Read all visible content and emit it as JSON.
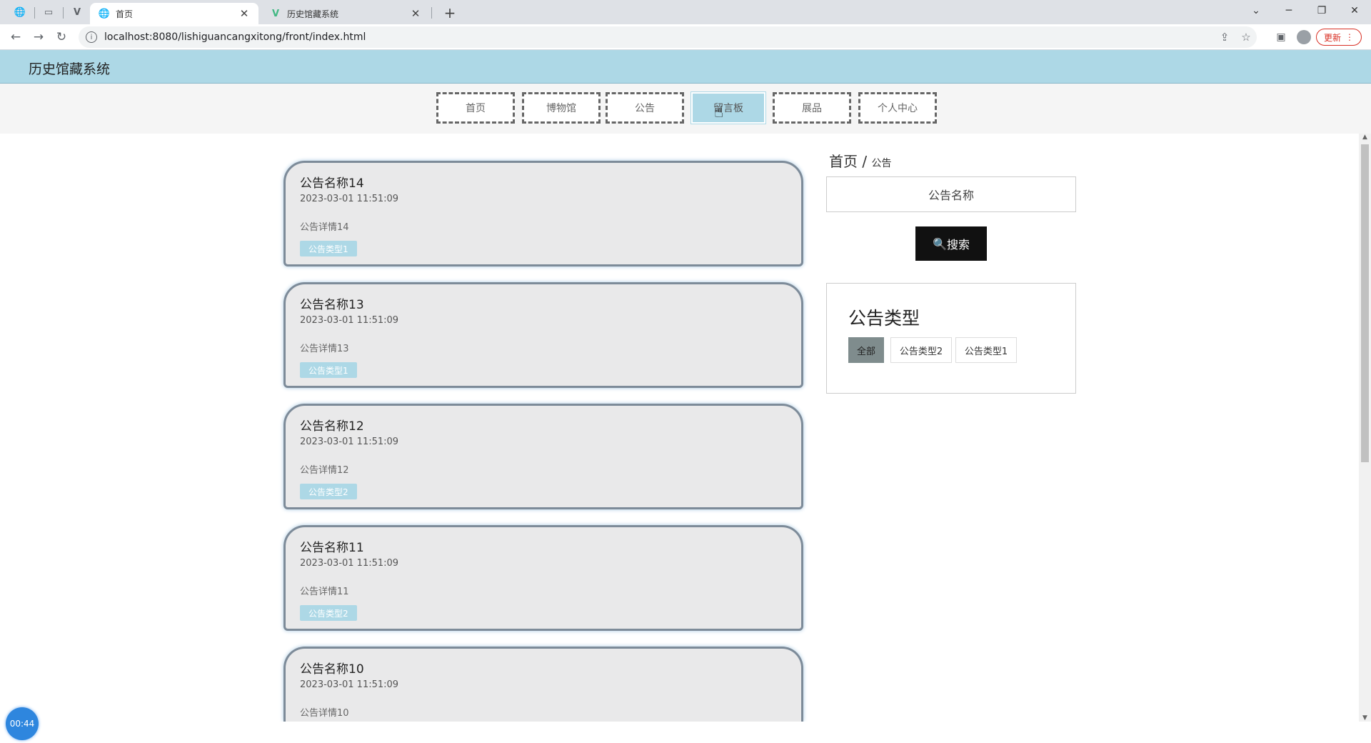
{
  "browser": {
    "tabs": [
      {
        "title": "首页",
        "icon": "globe-icon"
      },
      {
        "title": "历史馆藏系统",
        "icon": "vue-logo-icon"
      }
    ],
    "url": "localhost:8080/lishiguancangxitong/front/index.html",
    "update_label": "更新"
  },
  "site": {
    "title": "历史馆藏系统",
    "menu": [
      "首页",
      "博物馆",
      "公告",
      "留言板",
      "展品",
      "个人中心"
    ],
    "active_menu_index": 3
  },
  "notices": [
    {
      "title": "公告名称14",
      "time": "2023-03-01 11:51:09",
      "desc": "公告详情14",
      "type": "公告类型1"
    },
    {
      "title": "公告名称13",
      "time": "2023-03-01 11:51:09",
      "desc": "公告详情13",
      "type": "公告类型1"
    },
    {
      "title": "公告名称12",
      "time": "2023-03-01 11:51:09",
      "desc": "公告详情12",
      "type": "公告类型2"
    },
    {
      "title": "公告名称11",
      "time": "2023-03-01 11:51:09",
      "desc": "公告详情11",
      "type": "公告类型2"
    },
    {
      "title": "公告名称10",
      "time": "2023-03-01 11:51:09",
      "desc": "公告详情10",
      "type": ""
    }
  ],
  "sidebar": {
    "breadcrumb_home": "首页",
    "breadcrumb_sep": "/",
    "breadcrumb_current": "公告",
    "search_placeholder": "公告名称",
    "search_button": "搜索",
    "types_title": "公告类型",
    "types": [
      "全部",
      "公告类型2",
      "公告类型1"
    ]
  },
  "timer": "00:44"
}
